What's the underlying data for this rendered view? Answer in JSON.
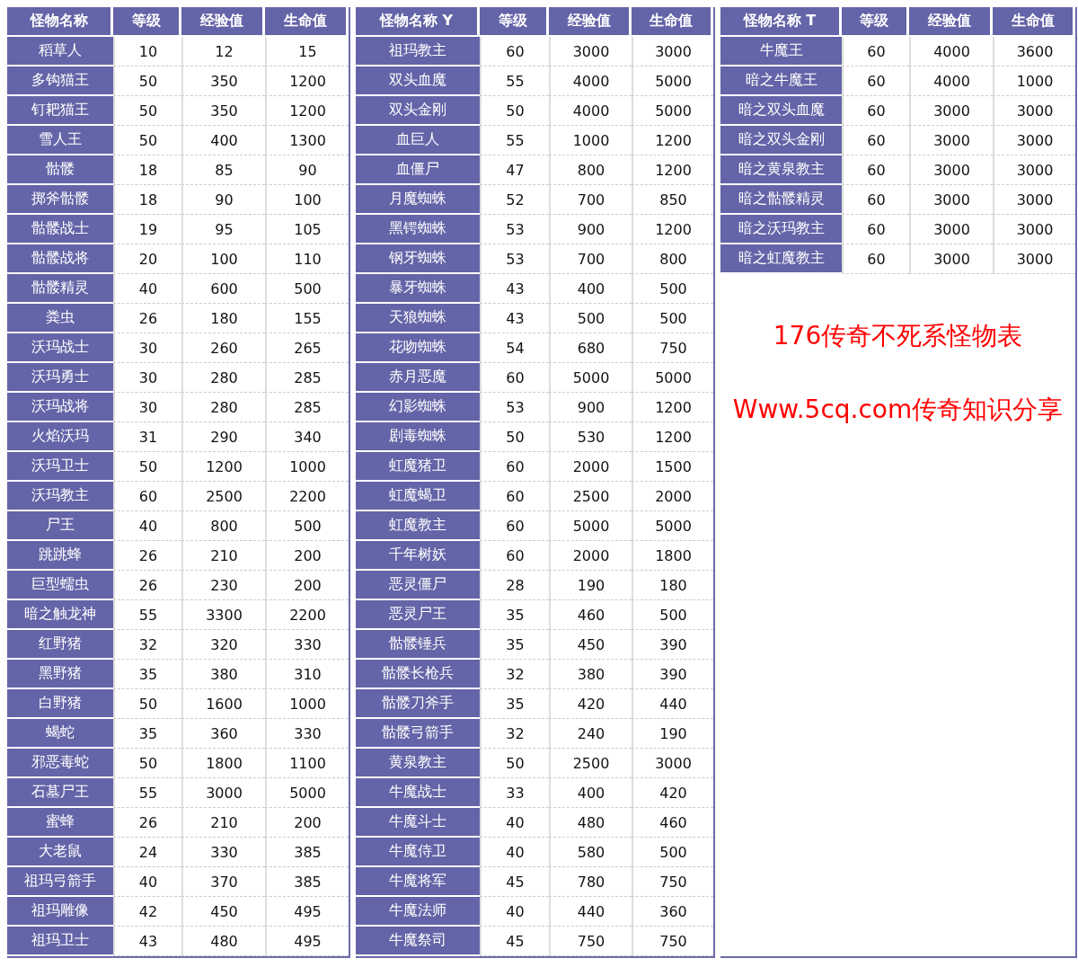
{
  "tables": [
    {
      "columns": [
        "怪物名称",
        "等级",
        "经验值",
        "生命值"
      ],
      "rows": [
        [
          "稻草人",
          "10",
          "12",
          "15"
        ],
        [
          "多钩猫王",
          "50",
          "350",
          "1200"
        ],
        [
          "钉耙猫王",
          "50",
          "350",
          "1200"
        ],
        [
          "雪人王",
          "50",
          "400",
          "1300"
        ],
        [
          "骷髅",
          "18",
          "85",
          "90"
        ],
        [
          "掷斧骷髅",
          "18",
          "90",
          "100"
        ],
        [
          "骷髅战士",
          "19",
          "95",
          "105"
        ],
        [
          "骷髅战将",
          "20",
          "100",
          "110"
        ],
        [
          "骷髅精灵",
          "40",
          "600",
          "500"
        ],
        [
          "粪虫",
          "26",
          "180",
          "155"
        ],
        [
          "沃玛战士",
          "30",
          "260",
          "265"
        ],
        [
          "沃玛勇士",
          "30",
          "280",
          "285"
        ],
        [
          "沃玛战将",
          "30",
          "280",
          "285"
        ],
        [
          "火焰沃玛",
          "31",
          "290",
          "340"
        ],
        [
          "沃玛卫士",
          "50",
          "1200",
          "1000"
        ],
        [
          "沃玛教主",
          "60",
          "2500",
          "2200"
        ],
        [
          "尸王",
          "40",
          "800",
          "500"
        ],
        [
          "跳跳蜂",
          "26",
          "210",
          "200"
        ],
        [
          "巨型蠕虫",
          "26",
          "230",
          "200"
        ],
        [
          "暗之触龙神",
          "55",
          "3300",
          "2200"
        ],
        [
          "红野猪",
          "32",
          "320",
          "330"
        ],
        [
          "黑野猪",
          "35",
          "380",
          "310"
        ],
        [
          "白野猪",
          "50",
          "1600",
          "1000"
        ],
        [
          "蝎蛇",
          "35",
          "360",
          "330"
        ],
        [
          "邪恶毒蛇",
          "50",
          "1800",
          "1100"
        ],
        [
          "石墓尸王",
          "55",
          "3000",
          "5000"
        ],
        [
          "蜜蜂",
          "26",
          "210",
          "200"
        ],
        [
          "大老鼠",
          "24",
          "330",
          "385"
        ],
        [
          "祖玛弓箭手",
          "40",
          "370",
          "385"
        ],
        [
          "祖玛雕像",
          "42",
          "450",
          "495"
        ],
        [
          "祖玛卫士",
          "43",
          "480",
          "495"
        ]
      ]
    },
    {
      "columns": [
        "怪物名称 Y",
        "等级",
        "经验值",
        "生命值"
      ],
      "rows": [
        [
          "祖玛教主",
          "60",
          "3000",
          "3000"
        ],
        [
          "双头血魔",
          "55",
          "4000",
          "5000"
        ],
        [
          "双头金刚",
          "50",
          "4000",
          "5000"
        ],
        [
          "血巨人",
          "55",
          "1000",
          "1200"
        ],
        [
          "血僵尸",
          "47",
          "800",
          "1200"
        ],
        [
          "月魔蜘蛛",
          "52",
          "700",
          "850"
        ],
        [
          "黑锷蜘蛛",
          "53",
          "900",
          "1200"
        ],
        [
          "钢牙蜘蛛",
          "53",
          "700",
          "800"
        ],
        [
          "暴牙蜘蛛",
          "43",
          "400",
          "500"
        ],
        [
          "天狼蜘蛛",
          "43",
          "500",
          "500"
        ],
        [
          "花吻蜘蛛",
          "54",
          "680",
          "750"
        ],
        [
          "赤月恶魔",
          "60",
          "5000",
          "5000"
        ],
        [
          "幻影蜘蛛",
          "53",
          "900",
          "1200"
        ],
        [
          "剧毒蜘蛛",
          "50",
          "530",
          "1200"
        ],
        [
          "虹魔猪卫",
          "60",
          "2000",
          "1500"
        ],
        [
          "虹魔蝎卫",
          "60",
          "2500",
          "2000"
        ],
        [
          "虹魔教主",
          "60",
          "5000",
          "5000"
        ],
        [
          "千年树妖",
          "60",
          "2000",
          "1800"
        ],
        [
          "恶灵僵尸",
          "28",
          "190",
          "180"
        ],
        [
          "恶灵尸王",
          "35",
          "460",
          "500"
        ],
        [
          "骷髅锤兵",
          "35",
          "450",
          "390"
        ],
        [
          "骷髅长枪兵",
          "32",
          "380",
          "390"
        ],
        [
          "骷髅刀斧手",
          "35",
          "420",
          "440"
        ],
        [
          "骷髅弓箭手",
          "32",
          "240",
          "190"
        ],
        [
          "黄泉教主",
          "50",
          "2500",
          "3000"
        ],
        [
          "牛魔战士",
          "33",
          "400",
          "420"
        ],
        [
          "牛魔斗士",
          "40",
          "480",
          "460"
        ],
        [
          "牛魔侍卫",
          "40",
          "580",
          "500"
        ],
        [
          "牛魔将军",
          "45",
          "780",
          "750"
        ],
        [
          "牛魔法师",
          "40",
          "440",
          "360"
        ],
        [
          "牛魔祭司",
          "45",
          "750",
          "750"
        ]
      ]
    },
    {
      "columns": [
        "怪物名称 T",
        "等级",
        "经验值",
        "生命值"
      ],
      "rows": [
        [
          "牛魔王",
          "60",
          "4000",
          "3600"
        ],
        [
          "暗之牛魔王",
          "60",
          "4000",
          "1000"
        ],
        [
          "暗之双头血魔",
          "60",
          "3000",
          "3000"
        ],
        [
          "暗之双头金刚",
          "60",
          "3000",
          "3000"
        ],
        [
          "暗之黄泉教主",
          "60",
          "3000",
          "3000"
        ],
        [
          "暗之骷髅精灵",
          "60",
          "3000",
          "3000"
        ],
        [
          "暗之沃玛教主",
          "60",
          "3000",
          "3000"
        ],
        [
          "暗之虹魔教主",
          "60",
          "3000",
          "3000"
        ]
      ]
    }
  ],
  "notes": [
    "176传奇不死系怪物表",
    "Www.5cq.com传奇知识分享"
  ]
}
